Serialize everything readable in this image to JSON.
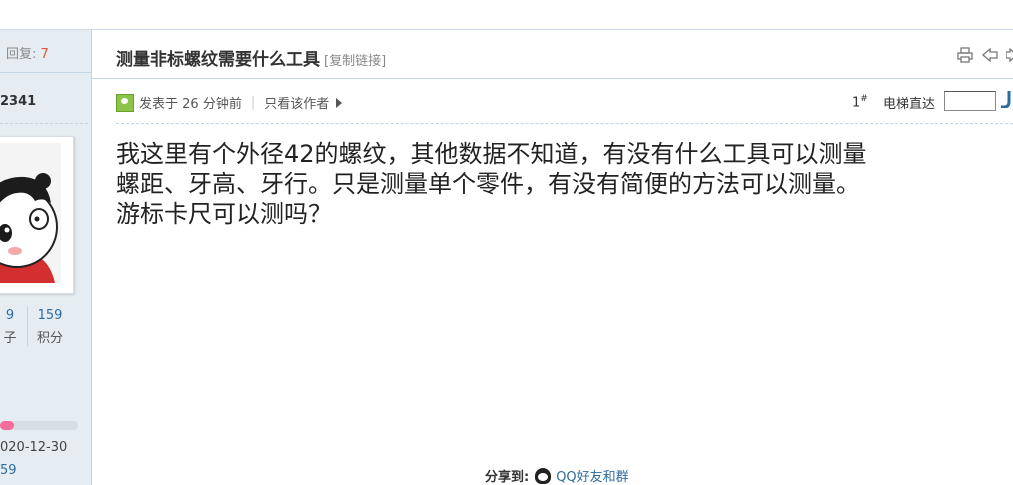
{
  "sidebar": {
    "reply_label": "回复:",
    "reply_count": "7",
    "user_id": "2341",
    "stats": [
      {
        "value": "9",
        "label": "子"
      },
      {
        "value": "159",
        "label": "积分"
      }
    ],
    "progress_fraction": 0.18,
    "date": "020-12-30",
    "number": "59"
  },
  "thread": {
    "title": "测量非标螺纹需要什么工具",
    "copy_link": "[复制链接]"
  },
  "post": {
    "author_prefix": "发表于",
    "post_time": "26 分钟前",
    "only_author": "只看该作者",
    "floor_num": "1",
    "floor_sup": "#",
    "jump_label": "电梯直达",
    "jump_value": "",
    "lines": [
      "我这里有个外径42的螺纹，其他数据不知道，有没有什么工具可以测量",
      "螺距、牙高、牙行。只是测量单个零件，有没有简便的方法可以测量。",
      "游标卡尺可以测吗？"
    ]
  },
  "share": {
    "label": "分享到:",
    "qq_label": "QQ好友和群"
  },
  "colors": {
    "link": "#2d6ca2",
    "reply_count": "#e7542e",
    "sidebar_bg": "#e5edf2",
    "progress": "#f36e9a"
  },
  "icons": [
    "print-icon",
    "prev-thread-icon",
    "next-thread-icon",
    "online-status-icon",
    "qq-icon",
    "jump-go-icon"
  ]
}
